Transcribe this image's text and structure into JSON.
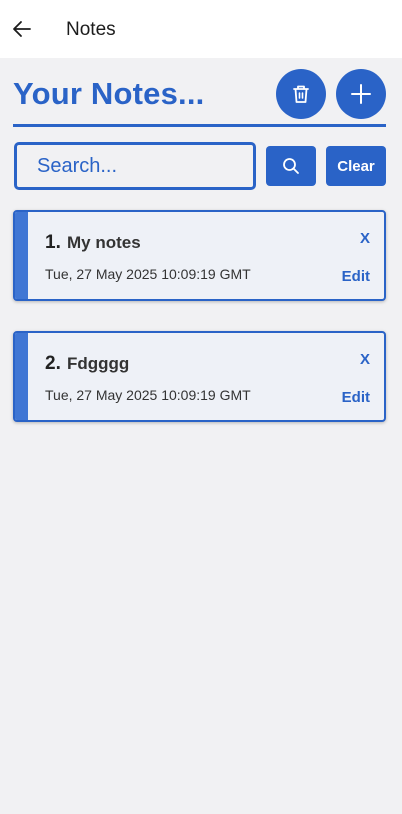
{
  "appbar": {
    "title": "Notes"
  },
  "header": {
    "title": "Your Notes..."
  },
  "search": {
    "placeholder": "Search...",
    "value": "",
    "clear_label": "Clear"
  },
  "notes": [
    {
      "number": "1.",
      "title": "My notes",
      "date": "Tue, 27 May 2025 10:09:19 GMT",
      "delete_label": "X",
      "edit_label": "Edit"
    },
    {
      "number": "2.",
      "title": "Fdgggg",
      "date": "Tue, 27 May 2025 10:09:19 GMT",
      "delete_label": "X",
      "edit_label": "Edit"
    }
  ],
  "icons": {
    "back": "arrow-left-icon",
    "trash": "trash-icon",
    "add": "plus-icon",
    "search": "search-icon"
  },
  "colors": {
    "accent": "#2a63c7",
    "background": "#f1f1f3",
    "card": "#eef1f7"
  }
}
